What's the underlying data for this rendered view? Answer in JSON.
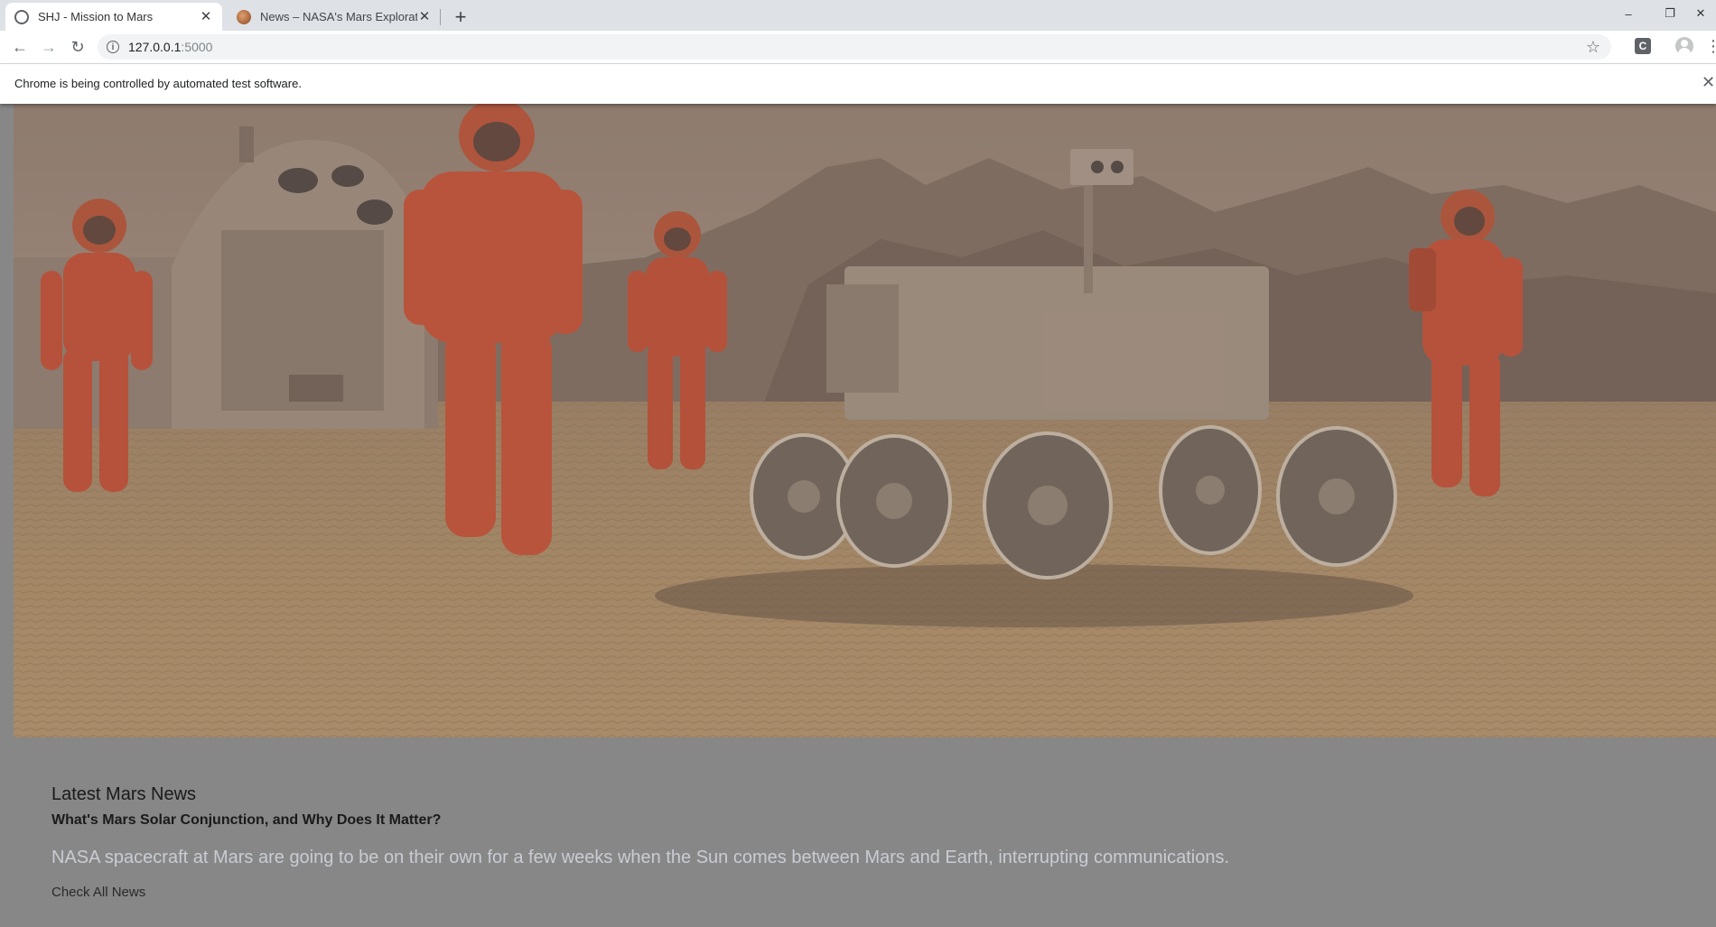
{
  "browser": {
    "tabs": [
      {
        "title": "SHJ - Mission to Mars",
        "active": true,
        "icon": "globe-icon"
      },
      {
        "title": "News – NASA's Mars Exploration",
        "active": false,
        "icon": "mars-favicon"
      }
    ],
    "new_tab_icon": "+",
    "window_controls": {
      "minimize": "–",
      "restore": "❐",
      "close": "✕"
    },
    "nav": {
      "back": "←",
      "forward": "→",
      "reload": "↻"
    },
    "url": {
      "host": "127.0.0.1",
      "port": ":5000"
    },
    "infobar": {
      "text": "Chrome is being controlled by automated test software.",
      "close": "✕"
    },
    "extension_label": "C"
  },
  "page": {
    "news": {
      "heading": "Latest Mars News",
      "title": "What's Mars Solar Conjunction, and Why Does It Matter?",
      "teaser": "NASA spacecraft at Mars are going to be on their own for a few weeks when the Sun comes between Mars and Earth, interrupting communications.",
      "link_label": "Check All News"
    },
    "colors": {
      "page_background": "#878787",
      "teaser_text": "#c9ccd3",
      "mars_ground": "#a98760",
      "suit_orange": "#c0462a"
    }
  }
}
